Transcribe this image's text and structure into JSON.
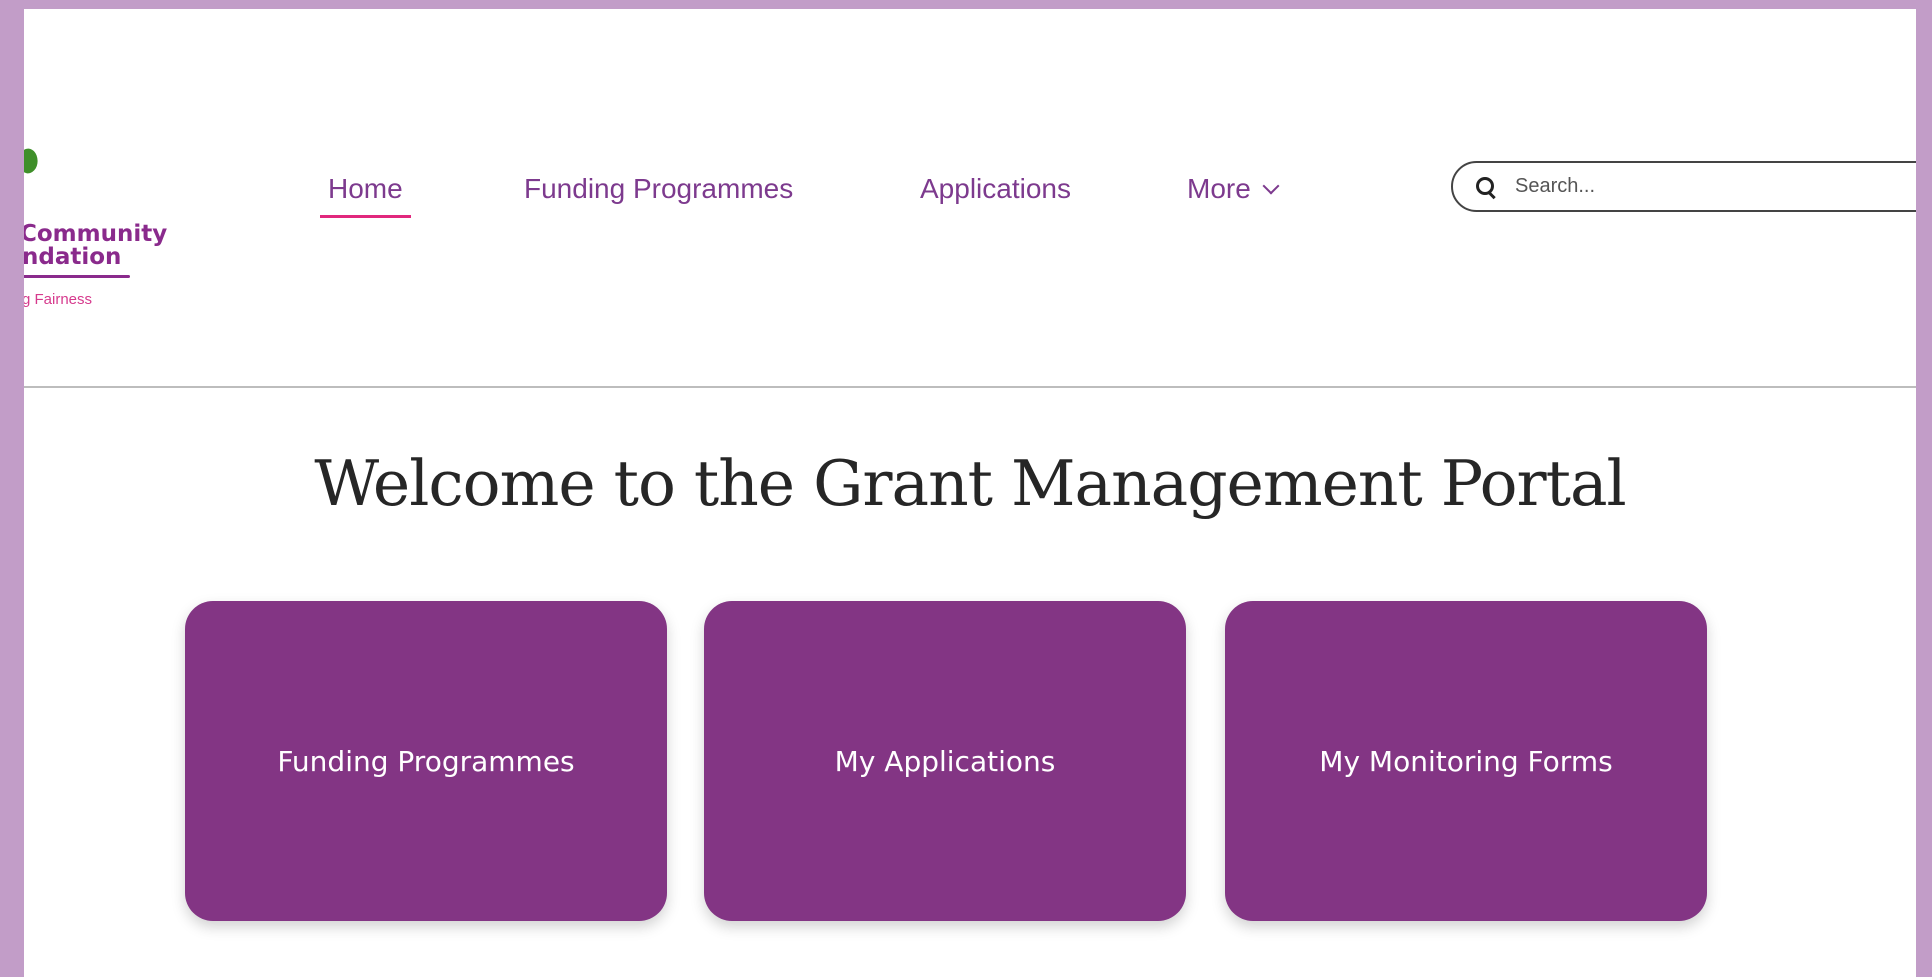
{
  "logo": {
    "line1": "Community",
    "line2": "ndation",
    "tagline": "g Fairness"
  },
  "nav": {
    "items": [
      {
        "label": "Home",
        "active": true
      },
      {
        "label": "Funding Programmes",
        "active": false
      },
      {
        "label": "Applications",
        "active": false
      },
      {
        "label": "More",
        "active": false
      }
    ]
  },
  "search": {
    "placeholder": "Search..."
  },
  "main": {
    "heading": "Welcome to the Grant Management Portal",
    "cards": [
      {
        "label": "Funding Programmes"
      },
      {
        "label": "My Applications"
      },
      {
        "label": "My Monitoring Forms"
      }
    ]
  },
  "colors": {
    "frame": "#c29dc8",
    "brand_purple": "#833584",
    "nav_text": "#7d3a8e",
    "active_underline": "#e1287d",
    "logo_leaf": "#3f8f2a",
    "logo_tagline": "#d63a8d"
  },
  "icons": {
    "search": "search-icon",
    "more": "chevron-down-icon",
    "logo_leaf": "leaf-icon"
  }
}
